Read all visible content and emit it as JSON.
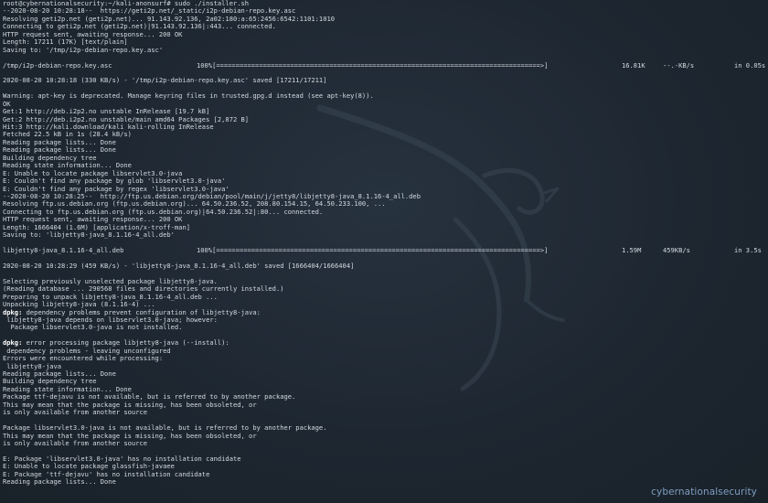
{
  "lines": [
    "root@cybernationalsecurity:~/kali-anonsurf# sudo ./installer.sh",
    "--2020-08-20 10:28:18--  https://geti2p.net/_static/i2p-debian-repo.key.asc",
    "Resolving geti2p.net (geti2p.net)... 91.143.92.136, 2a02:180:a:65:2456:6542:1101:1010",
    "Connecting to geti2p.net (geti2p.net)|91.143.92.136|:443... connected.",
    "HTTP request sent, awaiting response... 200 OK",
    "Length: 17211 (17K) [text/plain]",
    "Saving to: '/tmp/i2p-debian-repo.key.asc'",
    "",
    "",
    "",
    "2020-08-20 10:28:18 (330 KB/s) - '/tmp/i2p-debian-repo.key.asc' saved [17211/17211]",
    "",
    "Warning: apt-key is deprecated. Manage keyring files in trusted.gpg.d instead (see apt-key(8)).",
    "OK",
    "Get:1 http://deb.i2p2.no unstable InRelease [19.7 kB]",
    "Get:2 http://deb.i2p2.no unstable/main amd64 Packages [2,872 B]",
    "Hit:3 http://kali.download/kali kali-rolling InRelease",
    "Fetched 22.5 kB in 1s (28.4 kB/s)",
    "Reading package lists... Done",
    "Reading package lists... Done",
    "Building dependency tree",
    "Reading state information... Done",
    "E: Unable to locate package libservlet3.0-java",
    "E: Couldn't find any package by glob 'libservlet3.0-java'",
    "E: Couldn't find any package by regex 'libservlet3.0-java'",
    "--2020-08-20 10:28:25--  http://ftp.us.debian.org/debian/pool/main/j/jetty8/libjetty8-java_8.1.16-4_all.deb",
    "Resolving ftp.us.debian.org (ftp.us.debian.org)... 64.50.236.52, 208.80.154.15, 64.50.233.100, ...",
    "Connecting to ftp.us.debian.org (ftp.us.debian.org)|64.50.236.52|:80... connected.",
    "HTTP request sent, awaiting response... 200 OK",
    "Length: 1666404 (1.6M) [application/x-troff-man]",
    "Saving to: 'libjetty8-java_8.1.16-4_all.deb'",
    "",
    "",
    "",
    "2020-08-20 10:28:29 (459 KB/s) - 'libjetty8-java_8.1.16-4_all.deb' saved [1666404/1666404]",
    "",
    "Selecting previously unselected package libjetty8-java.",
    "(Reading database ... 290568 files and directories currently installed.)",
    "Preparing to unpack libjetty8-java_8.1.16-4_all.deb ...",
    "Unpacking libjetty8-java (8.1.16-4) ...",
    {
      "bold": "dpkg:",
      "rest": " dependency problems prevent configuration of libjetty8-java:"
    },
    " libjetty8-java depends on libservlet3.0-java; however:",
    "  Package libservlet3.0-java is not installed.",
    "",
    {
      "bold": "dpkg:",
      "rest": " error processing package libjetty8-java (--install):"
    },
    " dependency problems - leaving unconfigured",
    "Errors were encountered while processing:",
    " libjetty8-java",
    "Reading package lists... Done",
    "Building dependency tree",
    "Reading state information... Done",
    "Package ttf-dejavu is not available, but is referred to by another package.",
    "This may mean that the package is missing, has been obsoleted, or",
    "is only available from another source",
    "",
    "Package libservlet3.0-java is not available, but is referred to by another package.",
    "This may mean that the package is missing, has been obsoleted, or",
    "is only available from another source",
    "",
    "E: Package 'libservlet3.0-java' has no installation candidate",
    "E: Unable to locate package glassfish-javaee",
    "E: Package 'ttf-dejavu' has no installation candidate",
    "Reading package lists... Done"
  ],
  "progress": [
    {
      "after_line": 8,
      "file": "/tmp/i2p-debian-repo.key.asc",
      "bar": "100%[===================================================================================>]",
      "size": "16.81K",
      "rate": "--.-KB/s",
      "time": "in 0.05s"
    },
    {
      "after_line": 32,
      "file": "libjetty8-java_8.1.16-4_all.deb",
      "bar": "100%[===================================================================================>]",
      "size": "1.59M",
      "rate": "459KB/s",
      "time": "in 3.5s"
    }
  ],
  "brand": "cybernationalsecurity"
}
